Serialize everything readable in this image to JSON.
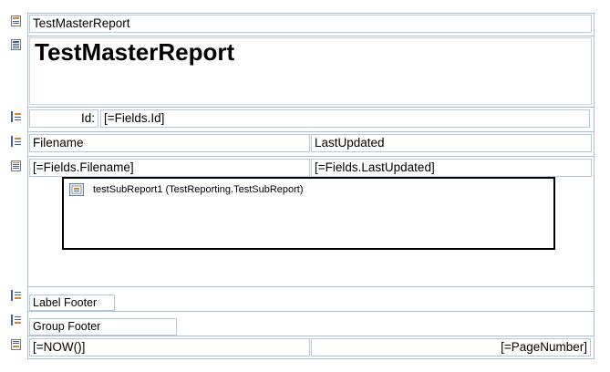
{
  "bands": {
    "report_header_label": "TestMasterReport",
    "page_header_title": "TestMasterReport",
    "group_header_id_label": "Id:",
    "group_header_id_field": "[=Fields.Id]",
    "column_headers": [
      "Filename",
      "LastUpdated"
    ],
    "detail_fields": [
      "[=Fields.Filename]",
      "[=Fields.LastUpdated]"
    ],
    "subreport_label": "testSubReport1 (TestReporting.TestSubReport)",
    "label_footer": "Label Footer",
    "group_footer": "Group Footer",
    "page_footer_left": "[=NOW()]",
    "page_footer_right": "[=PageNumber]"
  },
  "colors": {
    "band_border": "#a9c0d9",
    "icon_orange": "#d9822b",
    "icon_blue": "#3b63a8"
  },
  "icons": [
    "report-header-icon",
    "page-header-icon",
    "group-header-icon",
    "group-header-icon",
    "detail-icon",
    "subreport-icon",
    "group-footer-icon",
    "group-footer-icon",
    "page-footer-icon"
  ]
}
